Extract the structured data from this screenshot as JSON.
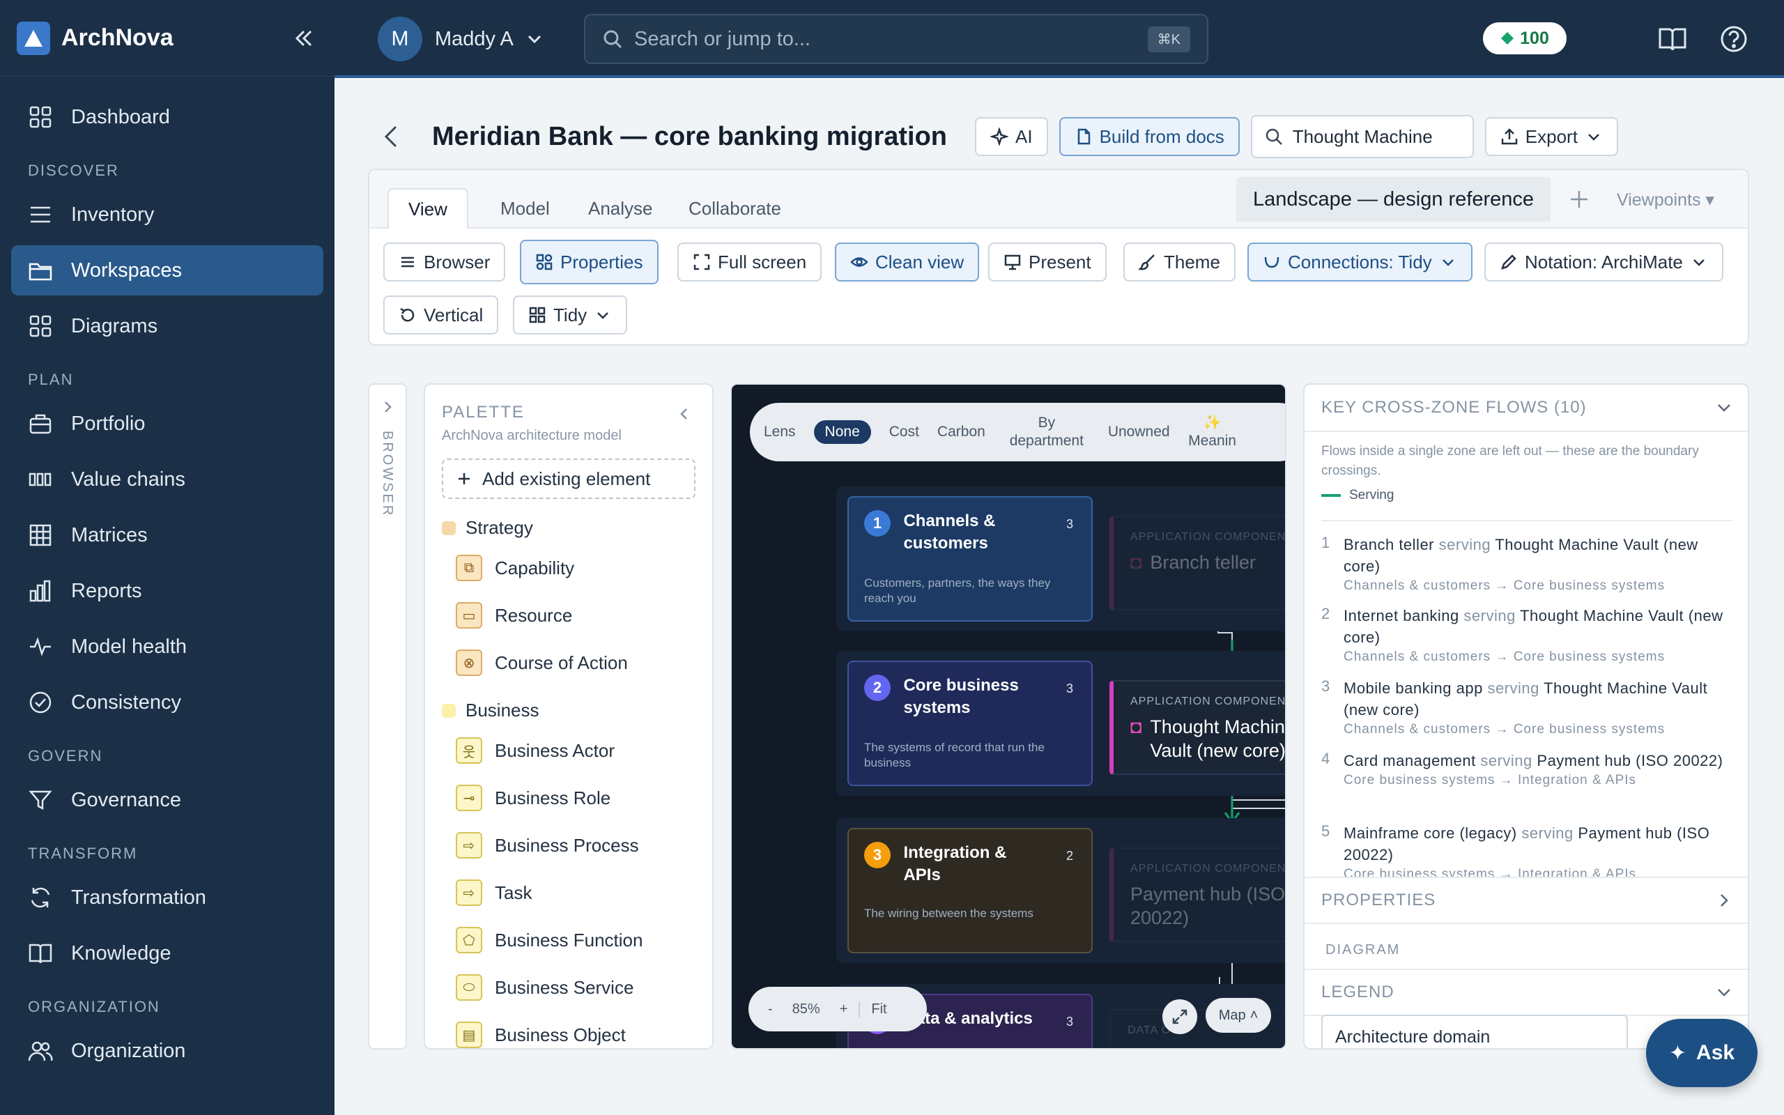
{
  "app": {
    "name": "ArchNova"
  },
  "colors": {
    "sidebar": "#1b3046",
    "accent": "#2a5a8c",
    "canvas": "#111a26",
    "serving": "#16a36b"
  },
  "sidebar": {
    "items_top": [
      {
        "label": "Dashboard",
        "icon": "grid-icon"
      }
    ],
    "sections": [
      {
        "title": "DISCOVER",
        "items": [
          {
            "label": "Inventory",
            "icon": "list-icon"
          },
          {
            "label": "Workspaces",
            "icon": "folder-icon",
            "active": true
          },
          {
            "label": "Diagrams",
            "icon": "grid-icon"
          }
        ]
      },
      {
        "title": "PLAN",
        "items": [
          {
            "label": "Portfolio",
            "icon": "briefcase-icon"
          },
          {
            "label": "Value chains",
            "icon": "columns-icon"
          },
          {
            "label": "Matrices",
            "icon": "table-icon"
          },
          {
            "label": "Reports",
            "icon": "bar-chart-icon"
          },
          {
            "label": "Model health",
            "icon": "pulse-icon"
          },
          {
            "label": "Consistency",
            "icon": "check-circle-icon"
          }
        ]
      },
      {
        "title": "GOVERN",
        "items": [
          {
            "label": "Governance",
            "icon": "filter-icon"
          }
        ]
      },
      {
        "title": "TRANSFORM",
        "items": [
          {
            "label": "Transformation",
            "icon": "refresh-icon"
          },
          {
            "label": "Knowledge",
            "icon": "book-icon"
          }
        ]
      },
      {
        "title": "ORGANIZATION",
        "items": [
          {
            "label": "Organization",
            "icon": "users-icon"
          }
        ]
      }
    ]
  },
  "topbar": {
    "avatar_initial": "M",
    "user_name": "Maddy A",
    "search_placeholder": "Search or jump to...",
    "shortcut": "⌘K",
    "credits": "100"
  },
  "header": {
    "title": "Meridian Bank — core banking migration",
    "ai_label": "AI",
    "build_label": "Build from docs",
    "search_value": "Thought Machine",
    "export_label": "Export"
  },
  "tabs": [
    "View",
    "Model",
    "Analyse",
    "Collaborate"
  ],
  "view_tab": "Landscape — design reference",
  "viewpoints": "Viewpoints",
  "toolbar": {
    "browser": "Browser",
    "properties": "Properties",
    "fullscreen": "Full screen",
    "cleanview": "Clean view",
    "present": "Present",
    "theme": "Theme",
    "connections": "Connections: Tidy",
    "notation": "Notation: ArchiMate",
    "vertical": "Vertical",
    "tidy": "Tidy"
  },
  "browser_label": "BROWSER",
  "palette": {
    "title": "PALETTE",
    "subtitle": "ArchNova architecture model",
    "add": "Add existing element",
    "groups": [
      {
        "label": "Strategy",
        "color": "#f6d9a8"
      },
      {
        "label": "Business",
        "color": "#fbf1a8"
      }
    ],
    "strategy_items": [
      "Capability",
      "Resource",
      "Course of Action"
    ],
    "business_items": [
      "Business Actor",
      "Business Role",
      "Business Process",
      "Task",
      "Business Function",
      "Business Service",
      "Business Object"
    ]
  },
  "lens": {
    "label": "Lens",
    "options": [
      "None",
      "Cost",
      "Carbon",
      "By department",
      "Unowned",
      "✨ Meanin"
    ],
    "active": "None"
  },
  "zones": [
    {
      "num": "1",
      "title": "Channels & customers",
      "count": "3",
      "desc": "Customers, partners, the ways they reach you",
      "app_kind": "APPLICATION COMPONENT",
      "app_name": "Branch teller"
    },
    {
      "num": "2",
      "title": "Core business systems",
      "count": "3",
      "desc": "The systems of record that run the business",
      "app_kind": "APPLICATION COMPONENT",
      "app_name": "Thought Machine Vault (new core)"
    },
    {
      "num": "3",
      "title": "Integration & APIs",
      "count": "2",
      "desc": "The wiring between the systems",
      "app_kind": "APPLICATION COMPONENT",
      "app_name": "Payment hub (ISO 20022)"
    },
    {
      "num": "4",
      "title": "Data & analytics",
      "count": "3",
      "desc": "",
      "app_kind": "DATA O",
      "app_name": ""
    }
  ],
  "zoom": {
    "minus": "-",
    "level": "85%",
    "plus": "+",
    "fit": "Fit",
    "map": "Map"
  },
  "flows_panel": {
    "title": "KEY CROSS-ZONE FLOWS (10)",
    "note": "Flows inside a single zone are left out — these are the boundary crossings.",
    "legend": "Serving",
    "flows": [
      {
        "n": "1",
        "from": "Branch teller",
        "rel": "serving",
        "to": "Thought Machine Vault (new core)",
        "path": "Channels & customers → Core business systems"
      },
      {
        "n": "2",
        "from": "Internet banking",
        "rel": "serving",
        "to": "Thought Machine Vault (new core)",
        "path": "Channels & customers → Core business systems"
      },
      {
        "n": "3",
        "from": "Mobile banking app",
        "rel": "serving",
        "to": "Thought Machine Vault (new core)",
        "path": "Channels & customers → Core business systems"
      },
      {
        "n": "4",
        "from": "Card management",
        "rel": "serving",
        "to": "Payment hub (ISO 20022)",
        "path": "Core business systems → Integration & APIs"
      },
      {
        "n": "5",
        "from": "Mainframe core (legacy)",
        "rel": "serving",
        "to": "Payment hub (ISO 20022)",
        "path": "Core business systems → Integration & APIs"
      }
    ],
    "properties": "PROPERTIES",
    "diagram": "DIAGRAM",
    "legend_title": "LEGEND",
    "arch_domain": "Architecture domain"
  },
  "ask": "Ask"
}
